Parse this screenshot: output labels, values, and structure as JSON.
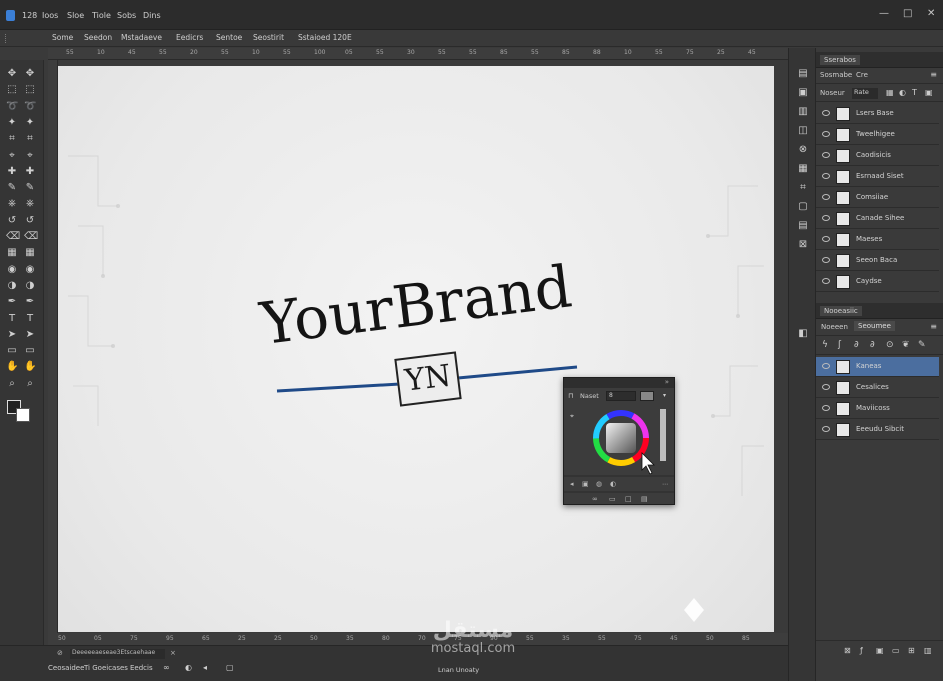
{
  "menubar": {
    "items": [
      "128",
      "Ioos",
      "Sloe",
      "Tiole",
      "Sobs",
      "Dins"
    ],
    "controls": [
      "—",
      "□",
      "✕"
    ]
  },
  "options_bar": {
    "items": [
      "Some",
      "Seedon",
      "Mstadaeve",
      "Eedicrs",
      "Sentoe",
      "Seostirit",
      "Sstaioed 120E"
    ]
  },
  "rulers": {
    "top_ticks": [
      "55",
      "10",
      "45",
      "55",
      "20",
      "55",
      "10",
      "55",
      "100",
      "05",
      "55",
      "30",
      "55",
      "55",
      "85",
      "55",
      "85",
      "88",
      "10",
      "55",
      "75",
      "25",
      "45"
    ],
    "bottom_ticks": [
      "50",
      "05",
      "75",
      "95",
      "65",
      "25",
      "25",
      "50",
      "35",
      "80",
      "70",
      "75",
      "90",
      "55",
      "35",
      "55",
      "75",
      "45",
      "50",
      "85"
    ]
  },
  "toolbar": {
    "tools": [
      "move-icon",
      "marquee-icon",
      "lasso-icon",
      "quick-select-icon",
      "crop-icon",
      "eyedropper-icon",
      "heal-icon",
      "brush-icon",
      "stamp-icon",
      "history-brush-icon",
      "eraser-icon",
      "gradient-icon",
      "blur-icon",
      "dodge-icon",
      "pen-icon",
      "type-icon",
      "path-select-icon",
      "shape-icon",
      "hand-icon",
      "zoom-icon"
    ]
  },
  "canvas": {
    "brand_text": "YourBrand",
    "monogram": "YN",
    "line_color": "#1f4a88"
  },
  "color_panel": {
    "tab_label": "Naset",
    "field_value": "8"
  },
  "right_panels": {
    "top_tab": "Sserabos",
    "top_sub_tabs": [
      "Sosmabe",
      "Cre"
    ],
    "top_filter": [
      "Noseur",
      "Rate"
    ],
    "layers_top": [
      {
        "label": "Lsers Base"
      },
      {
        "label": "Tweelhigee"
      },
      {
        "label": "Caodisicis"
      },
      {
        "label": "Esrnaad Siset"
      },
      {
        "label": "Comsiiae"
      },
      {
        "label": "Canade Sihee"
      },
      {
        "label": "Maeses"
      },
      {
        "label": "Seeon Baca"
      },
      {
        "label": "Caydse"
      }
    ],
    "bottom_tab": "Nooeasiic",
    "bottom_sub_tabs": [
      "Noeeen",
      "Seoumee"
    ],
    "layers_bottom": [
      {
        "label": "Kaneas",
        "selected": true
      },
      {
        "label": "Cesalices"
      },
      {
        "label": "Maviicoss"
      },
      {
        "label": "Eeeudu Sibcit"
      }
    ]
  },
  "status_bar": {
    "file_label": "Deeeeeaeseae3Etscaehaae",
    "left_items": [
      "Ceosaidee",
      "Ti Goeicases",
      "Eedcis"
    ],
    "center_text": "Lnan Unoaty"
  },
  "watermark": {
    "arabic": "مستقل",
    "latin": "mostaql.com"
  }
}
